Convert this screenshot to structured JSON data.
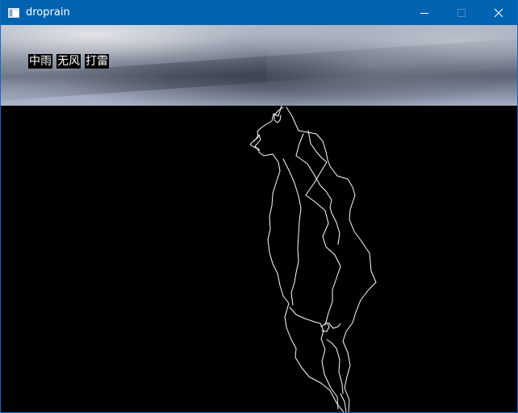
{
  "window": {
    "title": "droprain",
    "controls": {
      "minimize": "minimize-icon",
      "maximize": "maximize-icon",
      "close": "close-icon"
    }
  },
  "weather": {
    "labels": [
      "中雨",
      "无风",
      "打雷"
    ]
  },
  "colors": {
    "title_bar": "#0063b1",
    "canvas_background": "#000000",
    "lightning": "#ffffff",
    "sky_light": "#a6b0c6",
    "sky_dark": "#5c6475"
  },
  "icons": {
    "app": "app-window-icon",
    "minimize": "minimize-icon",
    "maximize": "maximize-icon",
    "close": "close-icon"
  }
}
